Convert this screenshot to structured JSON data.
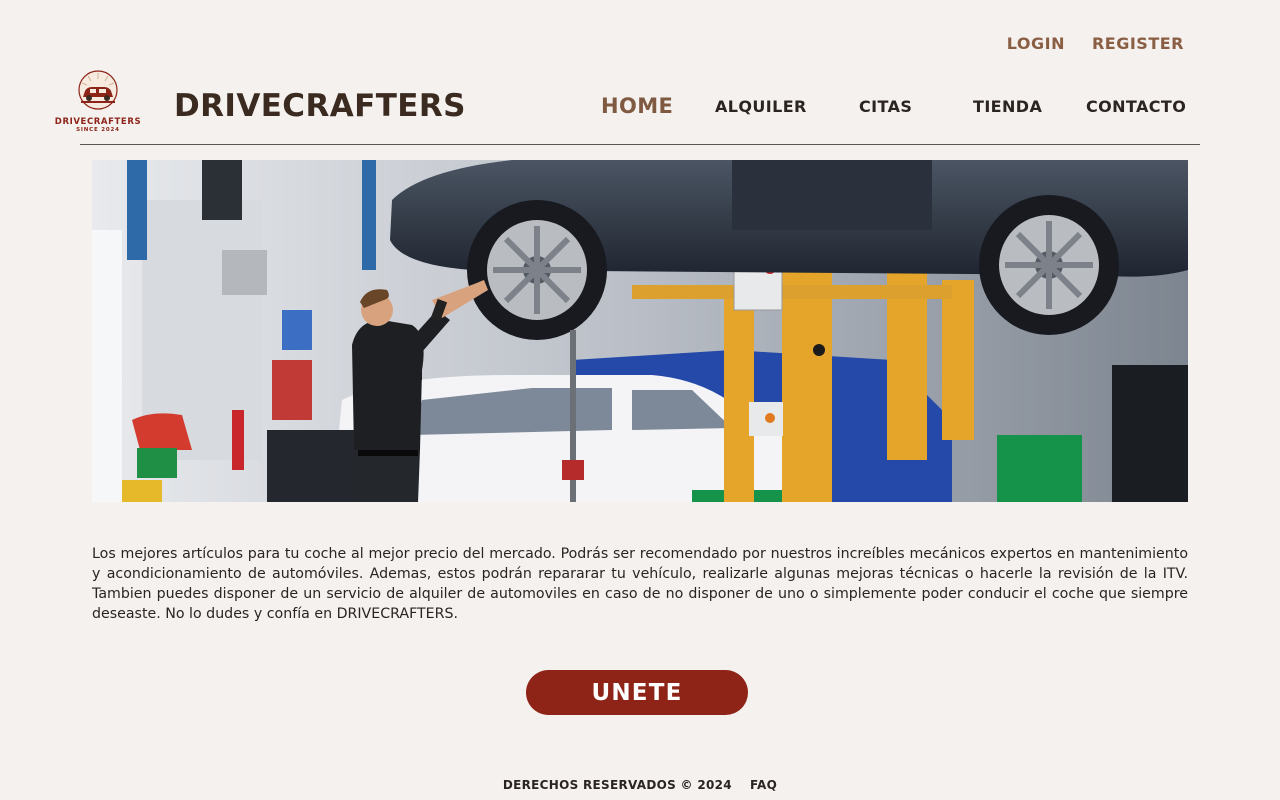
{
  "header": {
    "auth": {
      "login": "LOGIN",
      "register": "REGISTER"
    },
    "logo": {
      "name": "DRIVECRAFTERS",
      "since": "SINCE 2024",
      "icon": "car-emblem-icon"
    },
    "brand_title": "DRIVECRAFTERS",
    "nav": {
      "home": "HOME",
      "alquiler": "ALQUILER",
      "citas": "CITAS",
      "tienda": "TIENDA",
      "contacto": "CONTACTO",
      "active": "HOME"
    }
  },
  "hero": {
    "image": "mechanic-inspecting-car-on-lift"
  },
  "main": {
    "intro": "Los mejores artículos para tu coche al mejor precio del mercado. Podrás ser recomendado por nuestros increíbles mecánicos expertos  en mantenimiento y acondicionamiento de automóviles. Ademas, estos podrán repararar tu vehículo, realizarle algunas mejoras técnicas o hacerle la revisión de la ITV. Tambien puedes disponer de un servicio de alquiler de automoviles en caso de no disponer de uno o simplemente poder conducir el coche que siempre deseaste. No lo dudes y confía en DRIVECRAFTERS.",
    "cta_label": "UNETE"
  },
  "footer": {
    "copyright": "DERECHOS RESERVADOS © 2024",
    "faq": "FAQ"
  },
  "colors": {
    "background": "#f4f1ef",
    "accent_brown": "#8a5e43",
    "cta_red": "#8e2418",
    "text_dark": "#2b2420"
  }
}
